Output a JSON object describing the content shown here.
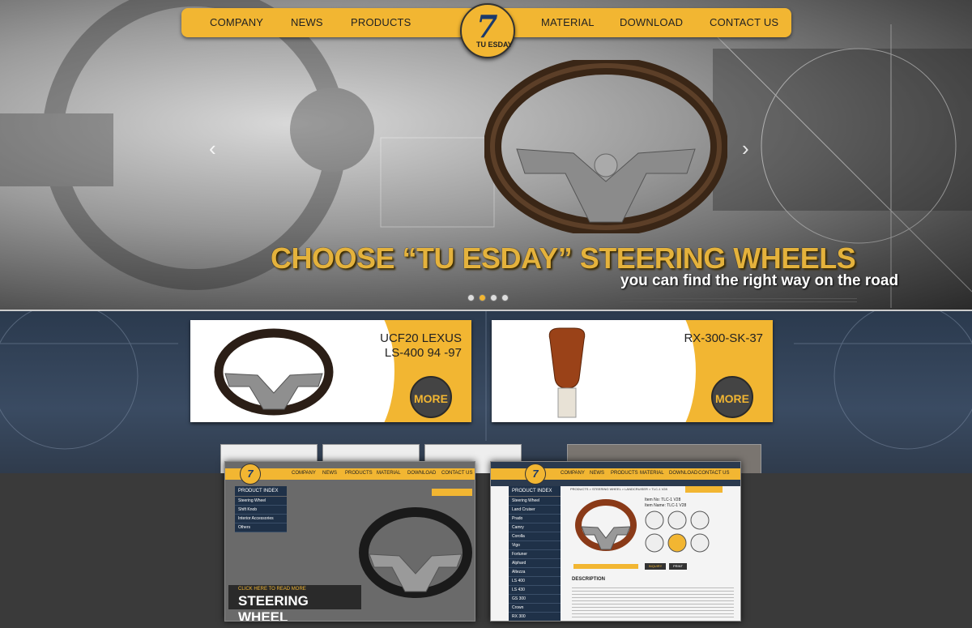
{
  "brand": {
    "logo_mark": "7",
    "logo_text": "TU ESDAY",
    "accent": "#f2b632"
  },
  "nav": {
    "company": "COMPANY",
    "news": "NEWS",
    "products": "PRODUCTS",
    "material": "MATERIAL",
    "download": "DOWNLOAD",
    "contact": "CONTACT US"
  },
  "hero": {
    "title": "CHOOSE “TU ESDAY” STEERING WHEELS",
    "subtitle": "you can find the right way on the road",
    "prev_icon": "‹",
    "next_icon": "›"
  },
  "products": [
    {
      "title_line1": "UCF20 LEXUS",
      "title_line2": "LS-400 94 -97",
      "more": "MORE"
    },
    {
      "title_line1": "",
      "title_line2": "RX-300-SK-37",
      "more": "MORE"
    }
  ],
  "screenshot_left": {
    "nav": [
      "COMPANY",
      "NEWS",
      "PRODUCTS",
      "MATERIAL",
      "DOWNLOAD",
      "CONTACT US"
    ],
    "index_title": "PRODUCT INDEX",
    "index_items": [
      "Steering Wheel",
      "Shift Knob",
      "Interior Accessories",
      "Others"
    ],
    "cta_kicker": "CLICK HERE TO READ MORE",
    "cta_title": "STEERING WHEEL"
  },
  "screenshot_right": {
    "nav": [
      "COMPANY",
      "NEWS",
      "PRODUCTS",
      "MATERIAL",
      "DOWNLOAD",
      "CONTACT US"
    ],
    "index_title": "PRODUCT INDEX",
    "index_items": [
      "Steering Wheel",
      "Land Cruiser",
      "Prado",
      "Camry",
      "Corolla",
      "Vigo",
      "Fortuner",
      "Alphard",
      "Altezza",
      "LS 400",
      "LS 430",
      "GS 300",
      "Crown",
      "RX 300"
    ],
    "breadcrumb": "PRODUCTS > STEERING WHEEL > LANDCRUISER > TLC-1 V28",
    "item_no": "Item No: TLC-1 V28",
    "item_name": "Item Name: TLC-1 V28",
    "inquiry": "INQUIRY",
    "print": "PRINT",
    "description": "DESCRIPTION"
  }
}
